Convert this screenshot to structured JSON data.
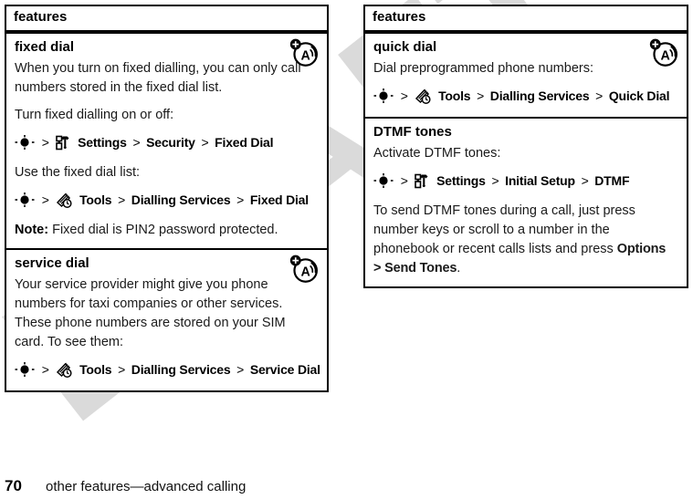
{
  "document": {
    "watermark": "DRAFT",
    "watermark_color": "#dadada"
  },
  "footer": {
    "page_number": "70",
    "title": "other features—advanced calling"
  },
  "left_column": {
    "table_header": "features",
    "sections": [
      {
        "title": "fixed dial",
        "badge_icon": "network-feature-icon",
        "blocks": [
          {
            "type": "text",
            "text": "When you turn on fixed dialling, you can only call numbers stored in the fixed dial list."
          },
          {
            "type": "text",
            "text": "Turn fixed dialling on or off:"
          },
          {
            "type": "path",
            "nav_key": "center-select-key-icon",
            "menu_icon": "settings-icon",
            "items": [
              "Settings",
              "Security",
              "Fixed Dial"
            ],
            "separator": ">"
          },
          {
            "type": "text",
            "text": "Use the fixed dial list:"
          },
          {
            "type": "path",
            "nav_key": "center-select-key-icon",
            "menu_icon": "tools-icon",
            "items": [
              "Tools",
              "Dialling Services",
              "Fixed Dial"
            ],
            "separator": ">"
          },
          {
            "type": "note",
            "label": "Note:",
            "text": " Fixed dial is PIN2 password protected."
          }
        ]
      },
      {
        "title": "service dial",
        "badge_icon": "network-feature-icon",
        "blocks": [
          {
            "type": "text",
            "text": "Your service provider might give you phone numbers for taxi companies or other services. These phone numbers are stored on your SIM card. To see them:"
          },
          {
            "type": "path",
            "nav_key": "center-select-key-icon",
            "menu_icon": "tools-icon",
            "items": [
              "Tools",
              "Dialling Services",
              "Service Dial"
            ],
            "separator": ">"
          }
        ]
      }
    ]
  },
  "right_column": {
    "table_header": "features",
    "sections": [
      {
        "title": "quick dial",
        "badge_icon": "network-feature-icon",
        "blocks": [
          {
            "type": "text",
            "text": "Dial preprogrammed phone numbers:"
          },
          {
            "type": "path",
            "nav_key": "center-select-key-icon",
            "menu_icon": "tools-icon",
            "items": [
              "Tools",
              "Dialling Services",
              "Quick Dial"
            ],
            "separator": ">"
          }
        ]
      },
      {
        "title": "DTMF tones",
        "badge_icon": null,
        "blocks": [
          {
            "type": "text",
            "text": "Activate DTMF tones:"
          },
          {
            "type": "path",
            "nav_key": "center-select-key-icon",
            "menu_icon": "settings-icon",
            "items": [
              "Settings",
              "Initial Setup",
              "DTMF"
            ],
            "separator": ">"
          },
          {
            "type": "mixed",
            "pre": "To send DTMF tones during a call, just press number keys or scroll to a number in the phonebook or recent calls lists and press ",
            "cmd_1": "Options",
            "cmd_sep": " > ",
            "cmd_2": "Send Tones",
            "post": "."
          }
        ]
      }
    ]
  }
}
